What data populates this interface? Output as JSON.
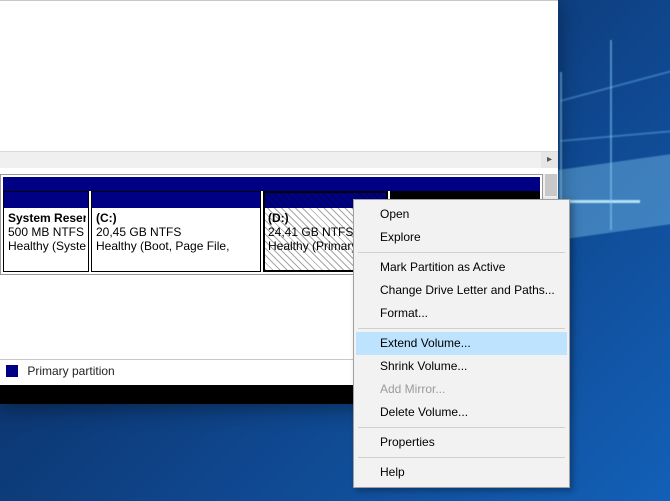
{
  "partitions": [
    {
      "title": "System Reser",
      "size": "500 MB NTFS",
      "status": "Healthy (Syster"
    },
    {
      "title": "(C:)",
      "size": "20,45 GB NTFS",
      "status": "Healthy (Boot, Page File,"
    },
    {
      "title": "(D:)",
      "size": "24,41 GB NTFS",
      "status": "Healthy (Primary P"
    },
    {
      "title": "",
      "size": "",
      "status": ""
    }
  ],
  "legend": {
    "primary": "Primary partition"
  },
  "menu": {
    "open": "Open",
    "explore": "Explore",
    "mark": "Mark Partition as Active",
    "letter": "Change Drive Letter and Paths...",
    "format": "Format...",
    "extend": "Extend Volume...",
    "shrink": "Shrink Volume...",
    "mirror": "Add Mirror...",
    "delete": "Delete Volume...",
    "props": "Properties",
    "help": "Help"
  }
}
